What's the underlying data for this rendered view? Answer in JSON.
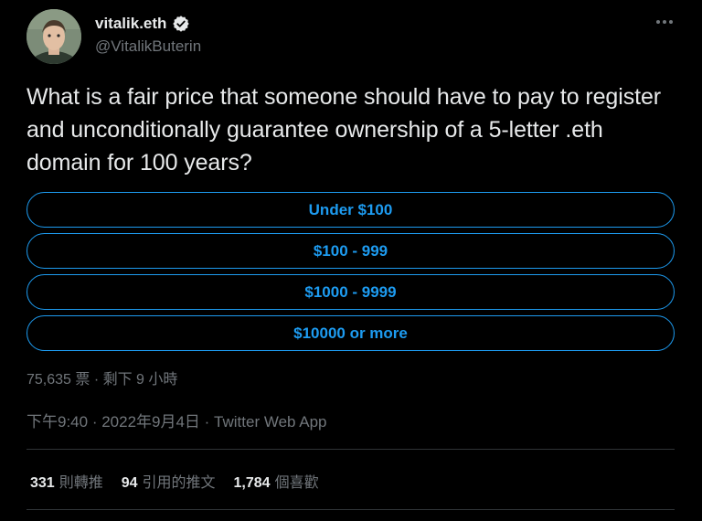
{
  "author": {
    "display_name": "vitalik.eth",
    "handle": "@VitalikButerin",
    "verified": true
  },
  "tweet": {
    "text": "What is a fair price that someone should have to pay to register and unconditionally guarantee ownership of a 5-letter .eth domain for 100 years?"
  },
  "poll": {
    "options": [
      {
        "label": "Under $100"
      },
      {
        "label": "$100 - 999"
      },
      {
        "label": "$1000 - 9999"
      },
      {
        "label": "$10000 or more"
      }
    ],
    "meta": "75,635 票 · 剩下 9 小時"
  },
  "timestamp": {
    "time": "下午9:40",
    "separator": " · ",
    "date": "2022年9月4日",
    "source": "Twitter Web App"
  },
  "stats": {
    "retweets_count": "331",
    "retweets_label": "則轉推",
    "quotes_count": "94",
    "quotes_label": "引用的推文",
    "likes_count": "1,784",
    "likes_label": "個喜歡"
  },
  "icons": {
    "verified": "verified-badge-icon",
    "more": "more-options-icon"
  },
  "colors": {
    "background": "#000000",
    "accent": "#1d9bf0",
    "text_primary": "#e7e9ea",
    "text_secondary": "#71767b",
    "divider": "#2f3336"
  }
}
